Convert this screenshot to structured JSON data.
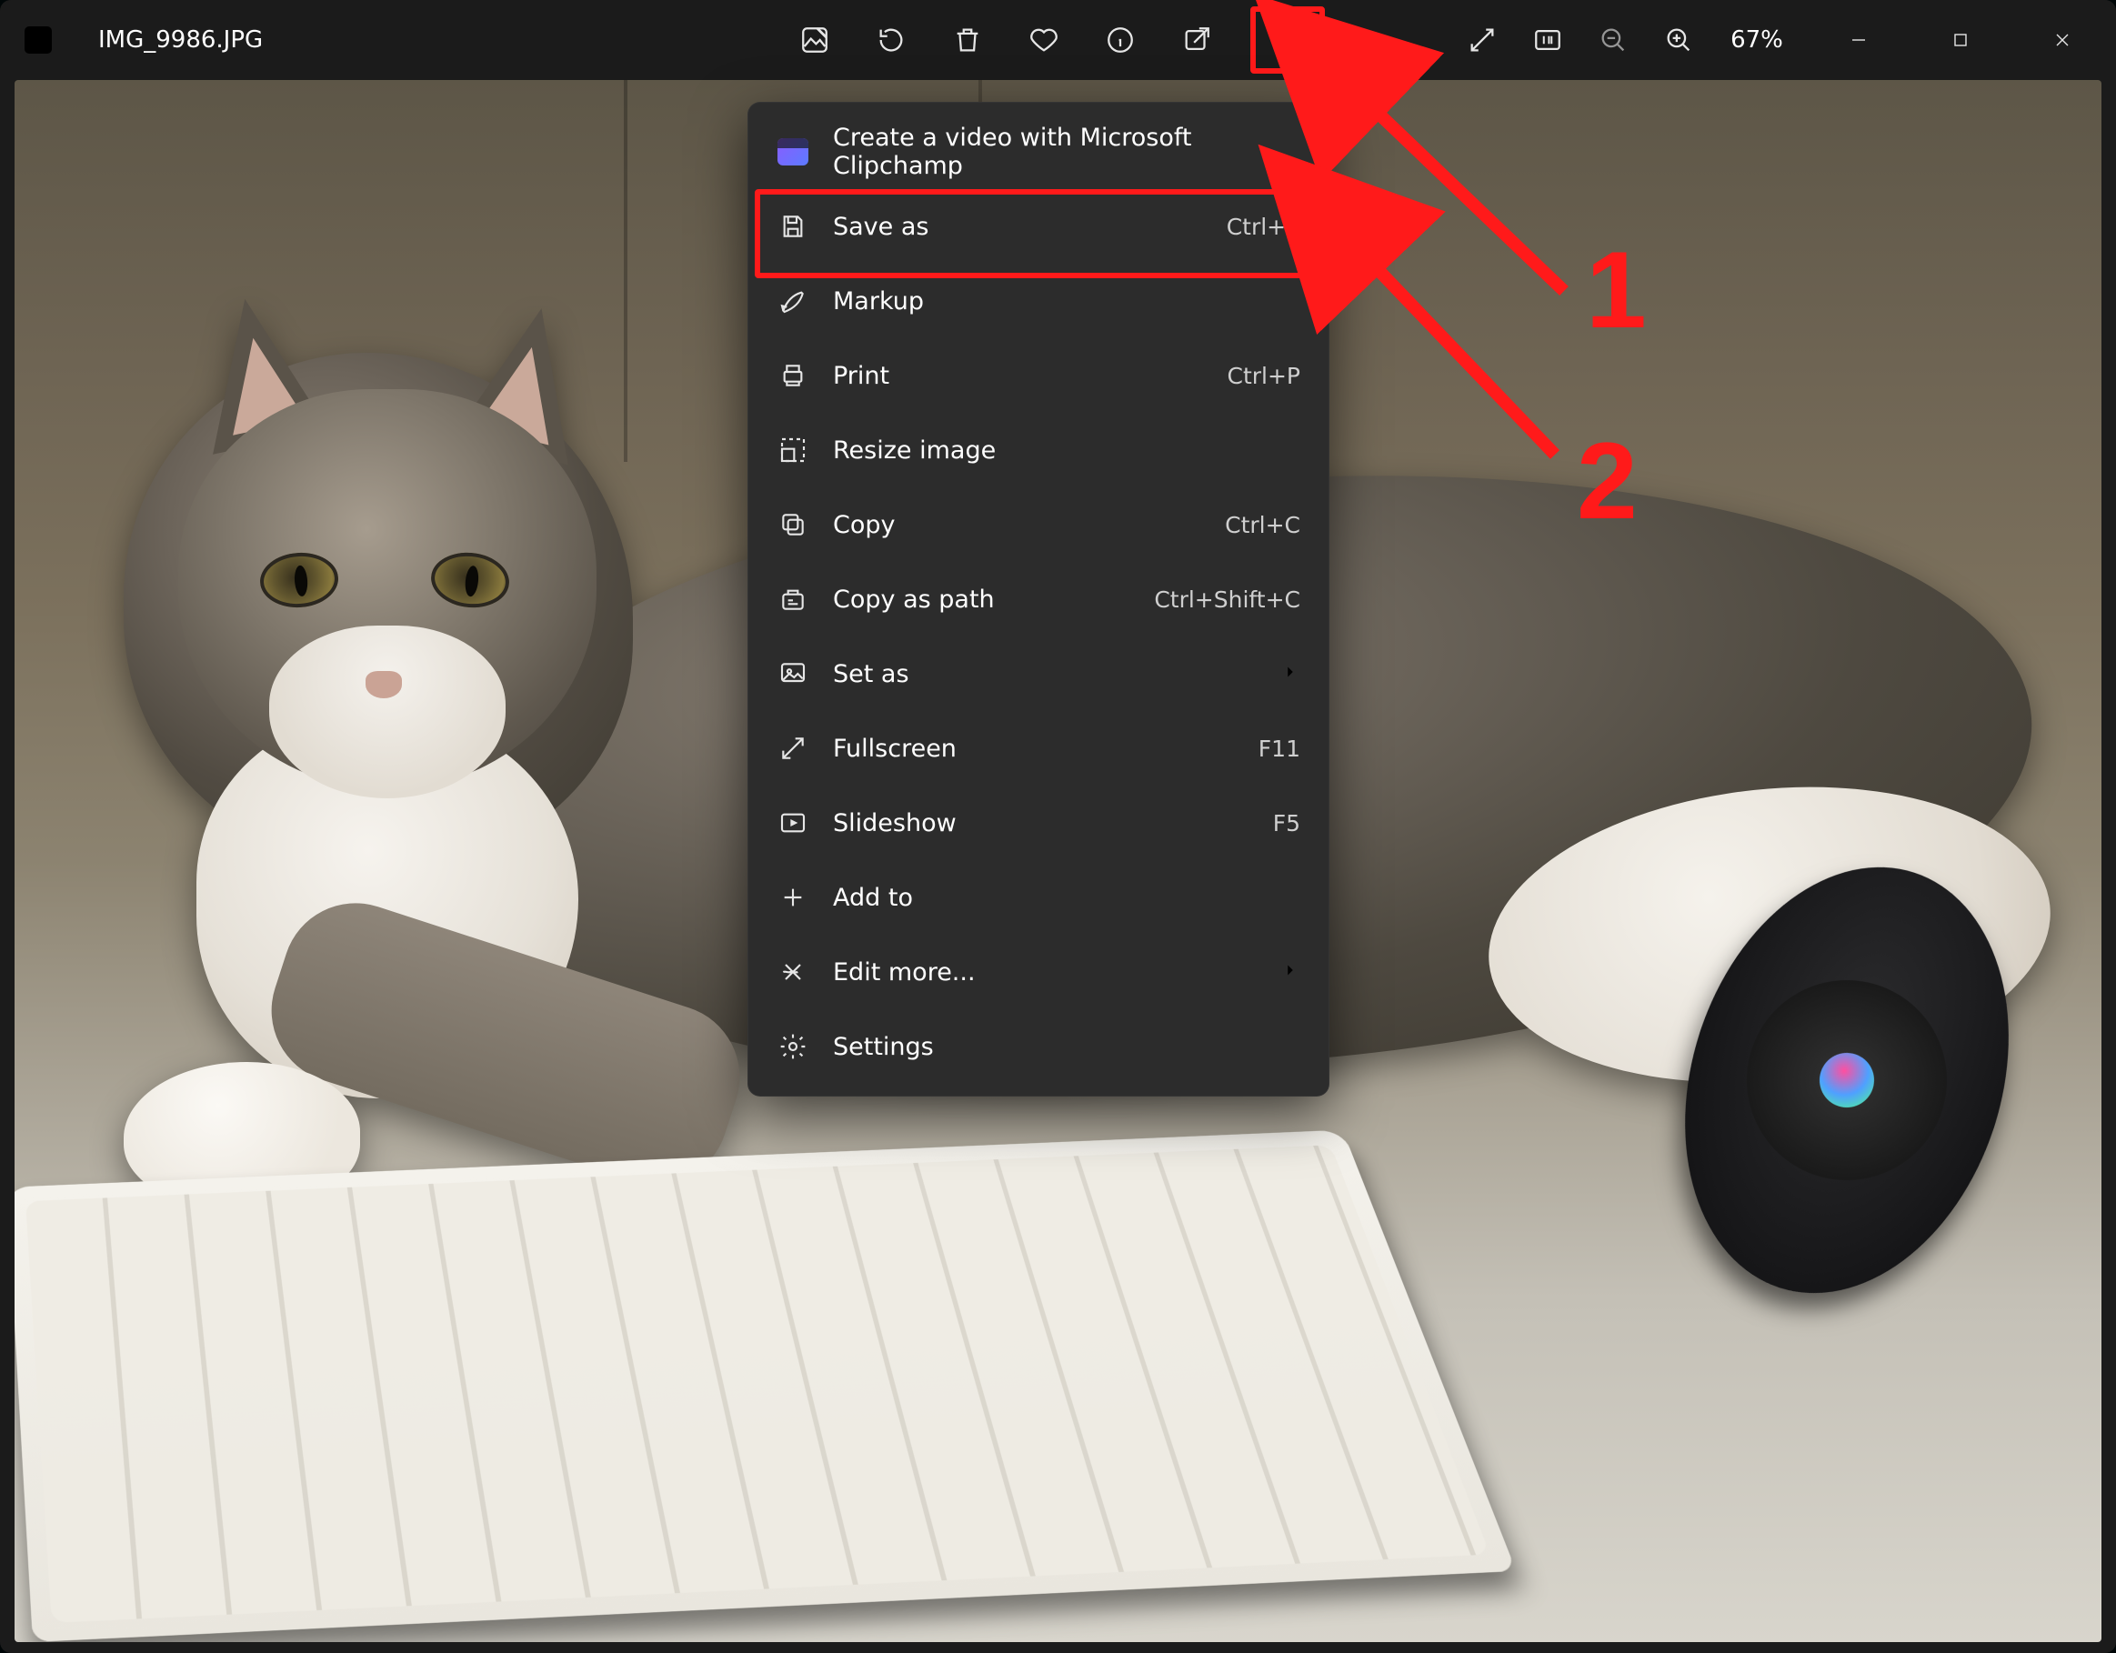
{
  "title_bar": {
    "filename": "IMG_9986.JPG",
    "zoom_pct": "67%"
  },
  "menu": {
    "items": [
      {
        "icon": "clipchamp-icon",
        "label": "Create a video with Microsoft Clipchamp",
        "hint": "",
        "kind": "item"
      },
      {
        "icon": "save-icon",
        "label": "Save as",
        "hint": "Ctrl+S",
        "kind": "item"
      },
      {
        "icon": "markup-icon",
        "label": "Markup",
        "hint": "",
        "kind": "item"
      },
      {
        "icon": "print-icon",
        "label": "Print",
        "hint": "Ctrl+P",
        "kind": "item"
      },
      {
        "icon": "resize-icon",
        "label": "Resize image",
        "hint": "",
        "kind": "item"
      },
      {
        "icon": "copy-icon",
        "label": "Copy",
        "hint": "Ctrl+C",
        "kind": "item"
      },
      {
        "icon": "copy-path-icon",
        "label": "Copy as path",
        "hint": "Ctrl+Shift+C",
        "kind": "item"
      },
      {
        "icon": "set-as-icon",
        "label": "Set as",
        "hint": "",
        "kind": "submenu"
      },
      {
        "icon": "fullscreen-icon",
        "label": "Fullscreen",
        "hint": "F11",
        "kind": "item"
      },
      {
        "icon": "slideshow-icon",
        "label": "Slideshow",
        "hint": "F5",
        "kind": "item"
      },
      {
        "icon": "add-icon",
        "label": "Add to",
        "hint": "",
        "kind": "item"
      },
      {
        "icon": "edit-more-icon",
        "label": "Edit more...",
        "hint": "",
        "kind": "submenu"
      },
      {
        "icon": "settings-icon",
        "label": "Settings",
        "hint": "",
        "kind": "item"
      }
    ]
  },
  "annotations": {
    "label_1": "1",
    "label_2": "2"
  }
}
